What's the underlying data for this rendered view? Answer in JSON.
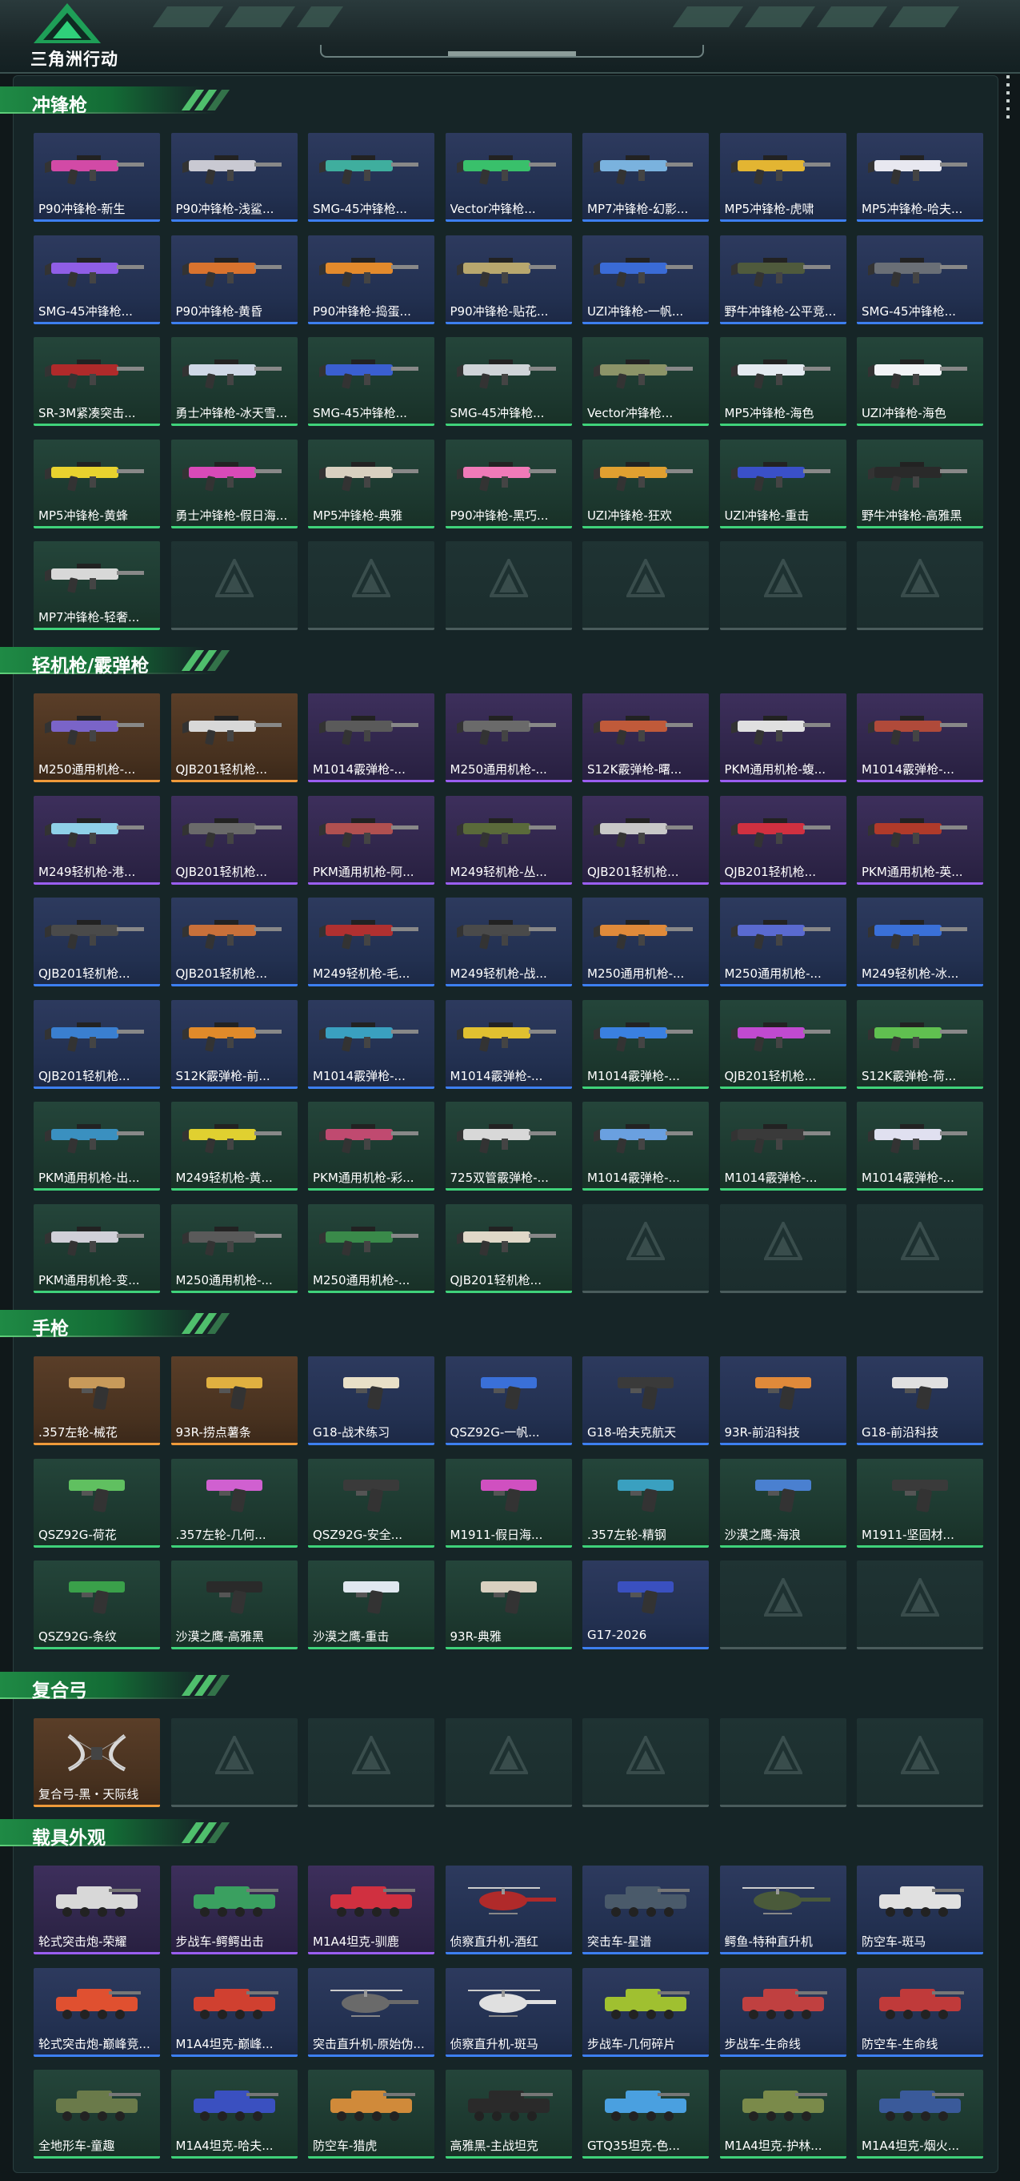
{
  "app": {
    "title": "三角洲行动"
  },
  "colors": {
    "accent_green": "#1f8a45",
    "quality_blue": "#3d7ff0",
    "quality_purple": "#9a5ef0",
    "quality_gold": "#ef9a3a",
    "quality_green": "#3fd27a"
  },
  "sections": [
    {
      "title": "冲锋枪",
      "items": [
        {
          "label": "P90冲锋枪-新生",
          "quality": "blue",
          "color": "#d24aa6",
          "kind": "gun"
        },
        {
          "label": "P90冲锋枪-浅鲨...",
          "quality": "blue",
          "color": "#c9c9d2",
          "kind": "gun"
        },
        {
          "label": "SMG-45冲锋枪...",
          "quality": "blue",
          "color": "#3fae9e",
          "kind": "gun"
        },
        {
          "label": "Vector冲锋枪...",
          "quality": "blue",
          "color": "#39c06b",
          "kind": "gun"
        },
        {
          "label": "MP7冲锋枪-幻影...",
          "quality": "blue",
          "color": "#7ab2de",
          "kind": "gun"
        },
        {
          "label": "MP5冲锋枪-虎啸",
          "quality": "blue",
          "color": "#e3b532",
          "kind": "gun"
        },
        {
          "label": "MP5冲锋枪-哈夫...",
          "quality": "blue",
          "color": "#e8e8f0",
          "kind": "gun"
        },
        {
          "label": "SMG-45冲锋枪...",
          "quality": "blue",
          "color": "#8f5ee6",
          "kind": "gun"
        },
        {
          "label": "P90冲锋枪-黄昏",
          "quality": "blue",
          "color": "#d9732e",
          "kind": "gun"
        },
        {
          "label": "P90冲锋枪-捣蛋...",
          "quality": "blue",
          "color": "#e38a2c",
          "kind": "gun"
        },
        {
          "label": "P90冲锋枪-贴花...",
          "quality": "blue",
          "color": "#b8a76e",
          "kind": "gun"
        },
        {
          "label": "UZI冲锋枪-一帆...",
          "quality": "blue",
          "color": "#3a6bd6",
          "kind": "gun"
        },
        {
          "label": "野牛冲锋枪-公平竞...",
          "quality": "blue",
          "color": "#4f5a3c",
          "kind": "gun"
        },
        {
          "label": "SMG-45冲锋枪...",
          "quality": "blue",
          "color": "#6a6f76",
          "kind": "gun"
        },
        {
          "label": "SR-3M紧凑突击...",
          "quality": "green",
          "color": "#b02a2a",
          "kind": "gun"
        },
        {
          "label": "勇士冲锋枪-冰天雪...",
          "quality": "green",
          "color": "#cfd8e6",
          "kind": "gun"
        },
        {
          "label": "SMG-45冲锋枪...",
          "quality": "green",
          "color": "#3a5fd0",
          "kind": "gun"
        },
        {
          "label": "SMG-45冲锋枪...",
          "quality": "green",
          "color": "#cfd4d8",
          "kind": "gun"
        },
        {
          "label": "Vector冲锋枪...",
          "quality": "green",
          "color": "#8c9468",
          "kind": "gun"
        },
        {
          "label": "MP5冲锋枪-海色",
          "quality": "green",
          "color": "#e4eaf0",
          "kind": "gun"
        },
        {
          "label": "UZI冲锋枪-海色",
          "quality": "green",
          "color": "#f2f4f6",
          "kind": "gun"
        },
        {
          "label": "MP5冲锋枪-黄蜂",
          "quality": "green",
          "color": "#e8d22e",
          "kind": "gun"
        },
        {
          "label": "勇士冲锋枪-假日海...",
          "quality": "green",
          "color": "#d84ab8",
          "kind": "gun"
        },
        {
          "label": "MP5冲锋枪-典雅",
          "quality": "green",
          "color": "#d8d0c0",
          "kind": "gun"
        },
        {
          "label": "P90冲锋枪-黑巧...",
          "quality": "green",
          "color": "#f07ab8",
          "kind": "gun"
        },
        {
          "label": "UZI冲锋枪-狂欢",
          "quality": "green",
          "color": "#e0a030",
          "kind": "gun"
        },
        {
          "label": "UZI冲锋枪-重击",
          "quality": "green",
          "color": "#3a50c8",
          "kind": "gun"
        },
        {
          "label": "野牛冲锋枪-高雅黑",
          "quality": "green",
          "color": "#2a2a2a",
          "kind": "gun"
        },
        {
          "label": "MP7冲锋枪-轻奢...",
          "quality": "green",
          "color": "#d8d8d8",
          "kind": "gun"
        },
        {
          "label": "",
          "quality": "empty"
        },
        {
          "label": "",
          "quality": "empty"
        },
        {
          "label": "",
          "quality": "empty"
        },
        {
          "label": "",
          "quality": "empty"
        },
        {
          "label": "",
          "quality": "empty"
        },
        {
          "label": "",
          "quality": "empty"
        }
      ]
    },
    {
      "title": "轻机枪/霰弹枪",
      "items": [
        {
          "label": "M250通用机枪-...",
          "quality": "gold",
          "color": "#7a64c8",
          "kind": "gun"
        },
        {
          "label": "QJB201轻机枪...",
          "quality": "gold",
          "color": "#d8d8d8",
          "kind": "gun"
        },
        {
          "label": "M1014霰弹枪-...",
          "quality": "purple",
          "color": "#5a5a5a",
          "kind": "gun"
        },
        {
          "label": "M250通用机枪-...",
          "quality": "purple",
          "color": "#6a6a6a",
          "kind": "gun"
        },
        {
          "label": "S12K霰弹枪-曙...",
          "quality": "purple",
          "color": "#c05a3a",
          "kind": "gun"
        },
        {
          "label": "PKM通用机枪-蝮...",
          "quality": "purple",
          "color": "#e0e0e0",
          "kind": "gun"
        },
        {
          "label": "M1014霰弹枪-...",
          "quality": "purple",
          "color": "#b04a3a",
          "kind": "gun"
        },
        {
          "label": "M249轻机枪-港...",
          "quality": "purple",
          "color": "#8fd0e8",
          "kind": "gun"
        },
        {
          "label": "QJB201轻机枪...",
          "quality": "purple",
          "color": "#6a6a6a",
          "kind": "gun"
        },
        {
          "label": "PKM通用机枪-阿...",
          "quality": "purple",
          "color": "#b05050",
          "kind": "gun"
        },
        {
          "label": "M249轻机枪-丛...",
          "quality": "purple",
          "color": "#5a6a3a",
          "kind": "gun"
        },
        {
          "label": "QJB201轻机枪...",
          "quality": "purple",
          "color": "#c8c8c8",
          "kind": "gun"
        },
        {
          "label": "QJB201轻机枪...",
          "quality": "purple",
          "color": "#d03040",
          "kind": "gun"
        },
        {
          "label": "PKM通用机枪-英...",
          "quality": "purple",
          "color": "#b03a2a",
          "kind": "gun"
        },
        {
          "label": "QJB201轻机枪...",
          "quality": "blue",
          "color": "#4a4a4a",
          "kind": "gun"
        },
        {
          "label": "QJB201轻机枪...",
          "quality": "blue",
          "color": "#c8703a",
          "kind": "gun"
        },
        {
          "label": "M249轻机枪-毛...",
          "quality": "blue",
          "color": "#b03030",
          "kind": "gun"
        },
        {
          "label": "M249轻机枪-战...",
          "quality": "blue",
          "color": "#4a4a4a",
          "kind": "gun"
        },
        {
          "label": "M250通用机枪-...",
          "quality": "blue",
          "color": "#e08a3a",
          "kind": "gun"
        },
        {
          "label": "M250通用机枪-...",
          "quality": "blue",
          "color": "#5a6ad0",
          "kind": "gun"
        },
        {
          "label": "M249轻机枪-冰...",
          "quality": "blue",
          "color": "#3a70d8",
          "kind": "gun"
        },
        {
          "label": "QJB201轻机枪...",
          "quality": "blue",
          "color": "#3a7fd0",
          "kind": "gun"
        },
        {
          "label": "S12K霰弹枪-前...",
          "quality": "blue",
          "color": "#e08a2a",
          "kind": "gun"
        },
        {
          "label": "M1014霰弹枪-...",
          "quality": "blue",
          "color": "#3aa0c0",
          "kind": "gun"
        },
        {
          "label": "M1014霰弹枪-...",
          "quality": "blue",
          "color": "#e0c030",
          "kind": "gun"
        },
        {
          "label": "M1014霰弹枪-...",
          "quality": "green",
          "color": "#3a80e0",
          "kind": "gun"
        },
        {
          "label": "QJB201轻机枪...",
          "quality": "green",
          "color": "#c04ad0",
          "kind": "gun"
        },
        {
          "label": "S12K霰弹枪-荷...",
          "quality": "green",
          "color": "#60c050",
          "kind": "gun"
        },
        {
          "label": "PKM通用机枪-出...",
          "quality": "green",
          "color": "#3a90c0",
          "kind": "gun"
        },
        {
          "label": "M249轻机枪-黄...",
          "quality": "green",
          "color": "#e0d030",
          "kind": "gun"
        },
        {
          "label": "PKM通用机枪-彩...",
          "quality": "green",
          "color": "#c04a70",
          "kind": "gun"
        },
        {
          "label": "725双管霰弹枪-...",
          "quality": "green",
          "color": "#d8d8d8",
          "kind": "gun"
        },
        {
          "label": "M1014霰弹枪-...",
          "quality": "green",
          "color": "#6aa0e0",
          "kind": "gun"
        },
        {
          "label": "M1014霰弹枪-...",
          "quality": "green",
          "color": "#3a3a3a",
          "kind": "gun"
        },
        {
          "label": "M1014霰弹枪-...",
          "quality": "green",
          "color": "#e0e0f0",
          "kind": "gun"
        },
        {
          "label": "PKM通用机枪-变...",
          "quality": "green",
          "color": "#d0d0d8",
          "kind": "gun"
        },
        {
          "label": "M250通用机枪-...",
          "quality": "green",
          "color": "#5a5a5a",
          "kind": "gun"
        },
        {
          "label": "M250通用机枪-...",
          "quality": "green",
          "color": "#3a8a4a",
          "kind": "gun"
        },
        {
          "label": "QJB201轻机枪...",
          "quality": "green",
          "color": "#e0d8c8",
          "kind": "gun"
        },
        {
          "label": "",
          "quality": "empty"
        },
        {
          "label": "",
          "quality": "empty"
        },
        {
          "label": "",
          "quality": "empty"
        }
      ]
    },
    {
      "title": "手枪",
      "items": [
        {
          "label": ".357左轮-械花",
          "quality": "gold",
          "color": "#c89a5a",
          "kind": "pistol"
        },
        {
          "label": "93R-捞点薯条",
          "quality": "gold",
          "color": "#e0b040",
          "kind": "pistol"
        },
        {
          "label": "G18-战术练习",
          "quality": "blue",
          "color": "#e8e0c8",
          "kind": "pistol"
        },
        {
          "label": "QSZ92G-一帆...",
          "quality": "blue",
          "color": "#3a70d8",
          "kind": "pistol"
        },
        {
          "label": "G18-哈夫克航天",
          "quality": "blue",
          "color": "#3a3a3a",
          "kind": "pistol"
        },
        {
          "label": "93R-前沿科技",
          "quality": "blue",
          "color": "#e08a3a",
          "kind": "pistol"
        },
        {
          "label": "G18-前沿科技",
          "quality": "blue",
          "color": "#e0e0e0",
          "kind": "pistol"
        },
        {
          "label": "QSZ92G-荷花",
          "quality": "green",
          "color": "#60c060",
          "kind": "pistol"
        },
        {
          "label": ".357左轮-几何...",
          "quality": "green",
          "color": "#d060d0",
          "kind": "pistol"
        },
        {
          "label": "QSZ92G-安全...",
          "quality": "green",
          "color": "#3a3a3a",
          "kind": "pistol"
        },
        {
          "label": "M1911-假日海...",
          "quality": "green",
          "color": "#d050c0",
          "kind": "pistol"
        },
        {
          "label": ".357左轮-精钢",
          "quality": "green",
          "color": "#3aa0c0",
          "kind": "pistol"
        },
        {
          "label": "沙漠之鹰-海浪",
          "quality": "green",
          "color": "#4a80d0",
          "kind": "pistol"
        },
        {
          "label": "M1911-坚固材...",
          "quality": "green",
          "color": "#3a3a3a",
          "kind": "pistol"
        },
        {
          "label": "QSZ92G-条纹",
          "quality": "green",
          "color": "#3aa04a",
          "kind": "pistol"
        },
        {
          "label": "沙漠之鹰-高雅黑",
          "quality": "green",
          "color": "#2a2a2a",
          "kind": "pistol"
        },
        {
          "label": "沙漠之鹰-重击",
          "quality": "green",
          "color": "#e0e8f0",
          "kind": "pistol"
        },
        {
          "label": "93R-典雅",
          "quality": "green",
          "color": "#d8d0c0",
          "kind": "pistol"
        },
        {
          "label": "G17-2026",
          "quality": "blue",
          "color": "#3a50c0",
          "kind": "pistol"
        },
        {
          "label": "",
          "quality": "empty"
        },
        {
          "label": "",
          "quality": "empty"
        }
      ]
    },
    {
      "title": "复合弓",
      "items": [
        {
          "label": "复合弓-黑・天际线",
          "quality": "gold",
          "color": "#d8d8d8",
          "kind": "bow"
        },
        {
          "label": "",
          "quality": "empty"
        },
        {
          "label": "",
          "quality": "empty"
        },
        {
          "label": "",
          "quality": "empty"
        },
        {
          "label": "",
          "quality": "empty"
        },
        {
          "label": "",
          "quality": "empty"
        },
        {
          "label": "",
          "quality": "empty"
        }
      ]
    },
    {
      "title": "载具外观",
      "items": [
        {
          "label": "轮式突击炮-荣耀",
          "quality": "purple",
          "color": "#d8d8d8",
          "kind": "vehicle"
        },
        {
          "label": "步战车-鳄鳄出击",
          "quality": "purple",
          "color": "#3aa060",
          "kind": "vehicle"
        },
        {
          "label": "M1A4坦克-驯鹿",
          "quality": "purple",
          "color": "#d03040",
          "kind": "vehicle"
        },
        {
          "label": "侦察直升机-酒红",
          "quality": "blue",
          "color": "#b02a2a",
          "kind": "heli"
        },
        {
          "label": "突击车-星谱",
          "quality": "blue",
          "color": "#4a5a6a",
          "kind": "vehicle"
        },
        {
          "label": "鳄鱼-特种直升机",
          "quality": "blue",
          "color": "#4a5a3a",
          "kind": "heli"
        },
        {
          "label": "防空车-斑马",
          "quality": "blue",
          "color": "#e0e0e0",
          "kind": "vehicle"
        },
        {
          "label": "轮式突击炮-巅峰竞...",
          "quality": "blue",
          "color": "#e05030",
          "kind": "vehicle"
        },
        {
          "label": "M1A4坦克-巅峰...",
          "quality": "blue",
          "color": "#d04030",
          "kind": "vehicle"
        },
        {
          "label": "突击直升机-原始伪...",
          "quality": "blue",
          "color": "#6a6a6a",
          "kind": "heli"
        },
        {
          "label": "侦察直升机-斑马",
          "quality": "blue",
          "color": "#e0e0e0",
          "kind": "heli"
        },
        {
          "label": "步战车-几何碎片",
          "quality": "blue",
          "color": "#a0c030",
          "kind": "vehicle"
        },
        {
          "label": "步战车-生命线",
          "quality": "blue",
          "color": "#c04040",
          "kind": "vehicle"
        },
        {
          "label": "防空车-生命线",
          "quality": "blue",
          "color": "#c03a3a",
          "kind": "vehicle"
        },
        {
          "label": "全地形车-童趣",
          "quality": "green",
          "color": "#6a7a4a",
          "kind": "vehicle"
        },
        {
          "label": "M1A4坦克-哈夫...",
          "quality": "green",
          "color": "#3a50c0",
          "kind": "vehicle"
        },
        {
          "label": "防空车-猎虎",
          "quality": "green",
          "color": "#d08a3a",
          "kind": "vehicle"
        },
        {
          "label": "高雅黑-主战坦克",
          "quality": "green",
          "color": "#2a2a2a",
          "kind": "vehicle"
        },
        {
          "label": "GTQ35坦克-色...",
          "quality": "green",
          "color": "#4aa0e0",
          "kind": "vehicle"
        },
        {
          "label": "M1A4坦克-护林...",
          "quality": "green",
          "color": "#7a8a4a",
          "kind": "vehicle"
        },
        {
          "label": "M1A4坦克-烟火...",
          "quality": "green",
          "color": "#3a5a9a",
          "kind": "vehicle"
        }
      ]
    }
  ]
}
